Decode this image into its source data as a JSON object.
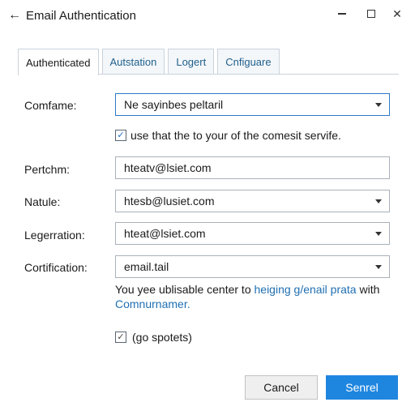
{
  "window": {
    "title": "Email Authentication",
    "back_glyph": "←",
    "close_glyph": "✕"
  },
  "tabs": [
    {
      "label": "Authenticated",
      "active": true
    },
    {
      "label": "Autstation",
      "active": false
    },
    {
      "label": "Logert",
      "active": false
    },
    {
      "label": "Cnfiguare",
      "active": false
    }
  ],
  "form": {
    "comfame": {
      "label": "Comfame:",
      "value": "Ne sayinbes peltaril"
    },
    "use_checkbox": {
      "checked": true,
      "label": "use that the to your of the comesit servife."
    },
    "pertchm": {
      "label": "Pertchm:",
      "value": "hteatv@lsiet.com"
    },
    "natule": {
      "label": "Natule:",
      "value": "htesb@lusiet.com"
    },
    "legerration": {
      "label": "Legerration:",
      "value": "hteat@lsiet.com"
    },
    "certification": {
      "label": "Cortification:",
      "value": "email.tail"
    }
  },
  "help": {
    "prefix": "You yee ublisable center to ",
    "link1": "heiging g/enail prata",
    "middle": " with ",
    "link2": "Comnurnamer."
  },
  "spotets_checkbox": {
    "checked": true,
    "label": "(go spotets)"
  },
  "buttons": {
    "cancel": "Cancel",
    "primary": "Senrel"
  },
  "colors": {
    "accent": "#1f86e0",
    "link": "#1f6fb3",
    "focus_border": "#2c79c6"
  },
  "check_glyph": "✓"
}
